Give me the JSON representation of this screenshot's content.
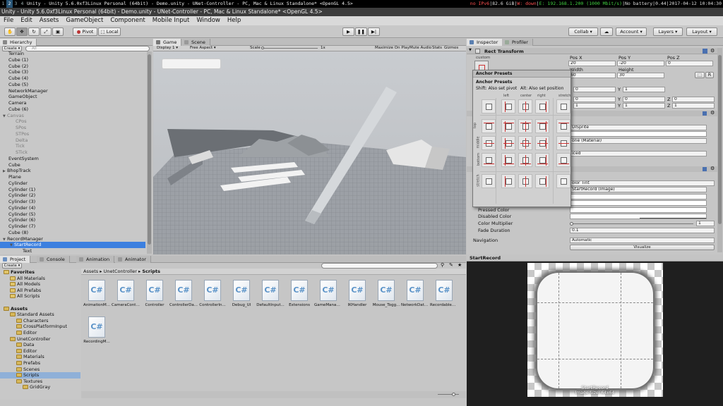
{
  "topbar": {
    "workspaces": [
      "1",
      "2",
      "3",
      "4",
      "5"
    ],
    "active_workspace": "2",
    "window_title": "Unity - Unity 5.6.0xf3Linux Personal (64bit) - Demo.unity - UNet-Controller - PC, Mac & Linux Standalone* <OpenGL 4.5>",
    "status_ipv6": "no IPv6",
    "status_disk": "82.6 GiB",
    "status_wifi": "W: down",
    "status_eth": "E: 192.168.1.200 (1000 Mbit/s)",
    "status_battery": "No battery",
    "status_load": "0.44",
    "status_time": "2017-04-12 10:04:30"
  },
  "title_bar": "Unity - Unity 5.6.0xf3Linux Personal (64bit) - Demo.unity - UNet-Controller - PC, Mac & Linux Standalone* <OpenGL 4.5>",
  "menu": [
    "File",
    "Edit",
    "Assets",
    "GameObject",
    "Component",
    "Mobile Input",
    "Window",
    "Help"
  ],
  "toolbar": {
    "pivot": "Pivot",
    "local": "Local",
    "collab": "Collab",
    "account": "Account",
    "layers": "Layers",
    "layout": "Layout"
  },
  "hierarchy": {
    "tab": "Hierarchy",
    "create": "Create",
    "search": "All",
    "items": [
      {
        "label": "Terrain",
        "indent": 0
      },
      {
        "label": "Cube (1)",
        "indent": 0
      },
      {
        "label": "Cube (2)",
        "indent": 0
      },
      {
        "label": "Cube (3)",
        "indent": 0
      },
      {
        "label": "Cube (4)",
        "indent": 0
      },
      {
        "label": "Cube (5)",
        "indent": 0
      },
      {
        "label": "NetworkManager",
        "indent": 0
      },
      {
        "label": "GameObject",
        "indent": 0
      },
      {
        "label": "Camera",
        "indent": 0
      },
      {
        "label": "Cube (6)",
        "indent": 0
      },
      {
        "label": "Canvas",
        "indent": 0,
        "open": true,
        "dim": true
      },
      {
        "label": "CPos",
        "indent": 1,
        "dim": true
      },
      {
        "label": "SPos",
        "indent": 1,
        "dim": true
      },
      {
        "label": "STPos",
        "indent": 1,
        "dim": true
      },
      {
        "label": "Delta",
        "indent": 1,
        "dim": true
      },
      {
        "label": "Tick",
        "indent": 1,
        "dim": true
      },
      {
        "label": "STick",
        "indent": 1,
        "dim": true
      },
      {
        "label": "EventSystem",
        "indent": 0
      },
      {
        "label": "Cube",
        "indent": 0
      },
      {
        "label": "BhopTrack",
        "indent": 0,
        "closed": true
      },
      {
        "label": "Plane",
        "indent": 0
      },
      {
        "label": "Cylinder",
        "indent": 0
      },
      {
        "label": "Cylinder (1)",
        "indent": 0
      },
      {
        "label": "Cylinder (2)",
        "indent": 0
      },
      {
        "label": "Cylinder (3)",
        "indent": 0
      },
      {
        "label": "Cylinder (4)",
        "indent": 0
      },
      {
        "label": "Cylinder (5)",
        "indent": 0
      },
      {
        "label": "Cylinder (6)",
        "indent": 0
      },
      {
        "label": "Cylinder (7)",
        "indent": 0
      },
      {
        "label": "Cube (8)",
        "indent": 0
      },
      {
        "label": "RecordManager",
        "indent": 0,
        "open": true
      },
      {
        "label": "StartRecord",
        "indent": 1,
        "open": true,
        "selected": true
      },
      {
        "label": "Text",
        "indent": 2
      }
    ]
  },
  "game": {
    "tab_game": "Game",
    "tab_scene": "Scene",
    "display": "Display 1",
    "aspect": "Free Aspect",
    "scale_label": "Scale",
    "scale_value": "1x",
    "maximize": "Maximize On Play",
    "mute": "Mute Audio",
    "stats": "Stats",
    "gizmos": "Gizmos"
  },
  "inspector": {
    "tab": "Inspector",
    "tab2": "Profiler",
    "component": "Rect Transform",
    "anchor_label": "custom",
    "pos_x_label": "Pos X",
    "pos_y_label": "Pos Y",
    "pos_z_label": "Pos Z",
    "pos_x": "20",
    "pos_y": "-20",
    "pos_z": "0",
    "width_label": "Width",
    "height_label": "Height",
    "width": "60",
    "height": "30",
    "r1a": "0",
    "r1b": "1",
    "r2a": "0",
    "r2b": "0",
    "r2c": "0",
    "r3a": "1",
    "r3b": "1",
    "r3c": "1",
    "y_lbl": "Y",
    "z_lbl": "Z",
    "r_btn": "R",
    "sprite": "UISprite",
    "material": "one (Material)",
    "image_type": "iced",
    "transition": "olor Tint",
    "target": "StartRecord (Image)",
    "pressed_color": "Pressed Color",
    "disabled_color": "Disabled Color",
    "color_multiplier": "Color Multiplier",
    "color_multiplier_val": "1",
    "fade_duration": "Fade Duration",
    "fade_duration_val": "0.1",
    "navigation": "Navigation",
    "navigation_val": "Automatic",
    "visualize": "Visualize"
  },
  "anchor_presets": {
    "title": "Anchor Presets",
    "subtitle": "Anchor Presets",
    "shift": "Shift: Also set pivot",
    "alt": "Alt: Also set position",
    "cols": [
      "left",
      "center",
      "right",
      "stretch"
    ],
    "rows": [
      "top",
      "middle",
      "bottom",
      "stretch"
    ]
  },
  "project": {
    "tab": "Project",
    "tab2": "Console",
    "tab3": "Animation",
    "tab4": "Animator",
    "create": "Create",
    "breadcrumb": [
      "Assets",
      "UnetController",
      "Scripts"
    ],
    "tree": [
      {
        "label": "Favorites",
        "indent": 0,
        "star": true,
        "bold": true
      },
      {
        "label": "All Materials",
        "indent": 1,
        "star": true
      },
      {
        "label": "All Models",
        "indent": 1,
        "star": true
      },
      {
        "label": "All Prefabs",
        "indent": 1,
        "star": true
      },
      {
        "label": "All Scripts",
        "indent": 1,
        "star": true
      },
      {
        "label": "",
        "indent": 0,
        "spacer": true
      },
      {
        "label": "Assets",
        "indent": 0,
        "bold": true
      },
      {
        "label": "Standard Assets",
        "indent": 1
      },
      {
        "label": "Characters",
        "indent": 2
      },
      {
        "label": "CrossPlatformInput",
        "indent": 2
      },
      {
        "label": "Editor",
        "indent": 2
      },
      {
        "label": "UnetController",
        "indent": 1
      },
      {
        "label": "Data",
        "indent": 2
      },
      {
        "label": "Editor",
        "indent": 2
      },
      {
        "label": "Materials",
        "indent": 2
      },
      {
        "label": "Prefabs",
        "indent": 2
      },
      {
        "label": "Scenes",
        "indent": 2
      },
      {
        "label": "Scripts",
        "indent": 2,
        "selected": true
      },
      {
        "label": "Textures",
        "indent": 2
      },
      {
        "label": "GridGray",
        "indent": 3
      }
    ],
    "assets": [
      "AnimationM...",
      "CameraContr...",
      "Controller",
      "ControllerDa...",
      "ControllerIn...",
      "Debug_UI",
      "DefaultInput...",
      "Extensions",
      "GameManager",
      "IKHandler",
      "Mouse_Togg...",
      "NetworkData...",
      "RecordableO...",
      "RecordingM..."
    ],
    "asset_glyph": "C#"
  },
  "preview": {
    "tab": "StartRecord",
    "caption": "StartRecord",
    "subcaption": "Image Size: 64x64"
  },
  "colors": {
    "selection": "#3d80df",
    "anchor_red": "#d03030",
    "csharp": "#5b93c8"
  }
}
